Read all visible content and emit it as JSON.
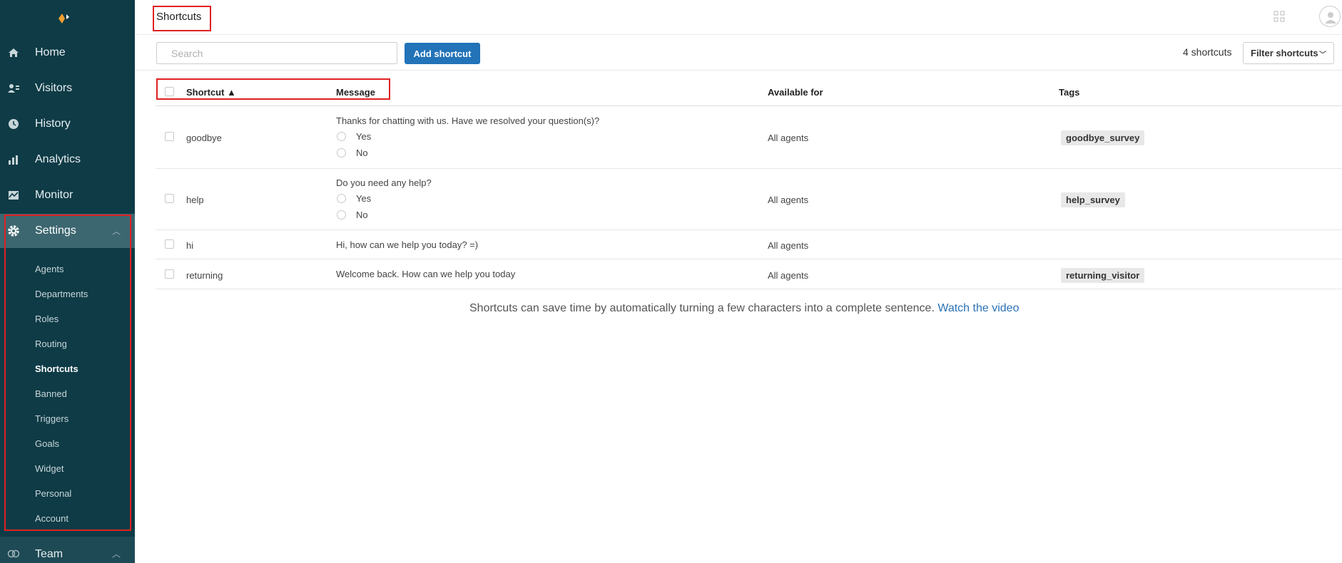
{
  "sidebar": {
    "nav": [
      {
        "label": "Home",
        "icon": "home-icon"
      },
      {
        "label": "Visitors",
        "icon": "visitors-icon"
      },
      {
        "label": "History",
        "icon": "clock-icon"
      },
      {
        "label": "Analytics",
        "icon": "bar-chart-icon"
      },
      {
        "label": "Monitor",
        "icon": "monitor-icon"
      },
      {
        "label": "Settings",
        "icon": "gear-icon"
      }
    ],
    "settings_items": [
      "Agents",
      "Departments",
      "Roles",
      "Routing",
      "Shortcuts",
      "Banned",
      "Triggers",
      "Goals",
      "Widget",
      "Personal",
      "Account"
    ],
    "active_settings_item": "Shortcuts",
    "team_label": "Team"
  },
  "header": {
    "title": "Shortcuts"
  },
  "toolbar": {
    "search_placeholder": "Search",
    "add_label": "Add shortcut",
    "count_text": "4 shortcuts",
    "filter_label": "Filter shortcuts"
  },
  "table": {
    "columns": {
      "shortcut": "Shortcut ▲",
      "message": "Message",
      "available": "Available for",
      "tags": "Tags"
    },
    "rows": [
      {
        "shortcut": "goodbye",
        "message": "Thanks for chatting with us. Have we resolved your question(s)?",
        "options": [
          "Yes",
          "No"
        ],
        "available": "All agents",
        "tag": "goodbye_survey"
      },
      {
        "shortcut": "help",
        "message": "Do you need any help?",
        "options": [
          "Yes",
          "No"
        ],
        "available": "All agents",
        "tag": "help_survey"
      },
      {
        "shortcut": "hi",
        "message": "Hi, how can we help you today? =)",
        "options": [],
        "available": "All agents",
        "tag": ""
      },
      {
        "shortcut": "returning",
        "message": "Welcome back. How can we help you today",
        "options": [],
        "available": "All agents",
        "tag": "returning_visitor"
      }
    ]
  },
  "hint": {
    "text": "Shortcuts can save time by automatically turning a few characters into a complete sentence. ",
    "link": "Watch the video"
  },
  "colors": {
    "sidebar": "#0e3b46",
    "accent": "#2273b8",
    "highlight": "#e02020"
  }
}
